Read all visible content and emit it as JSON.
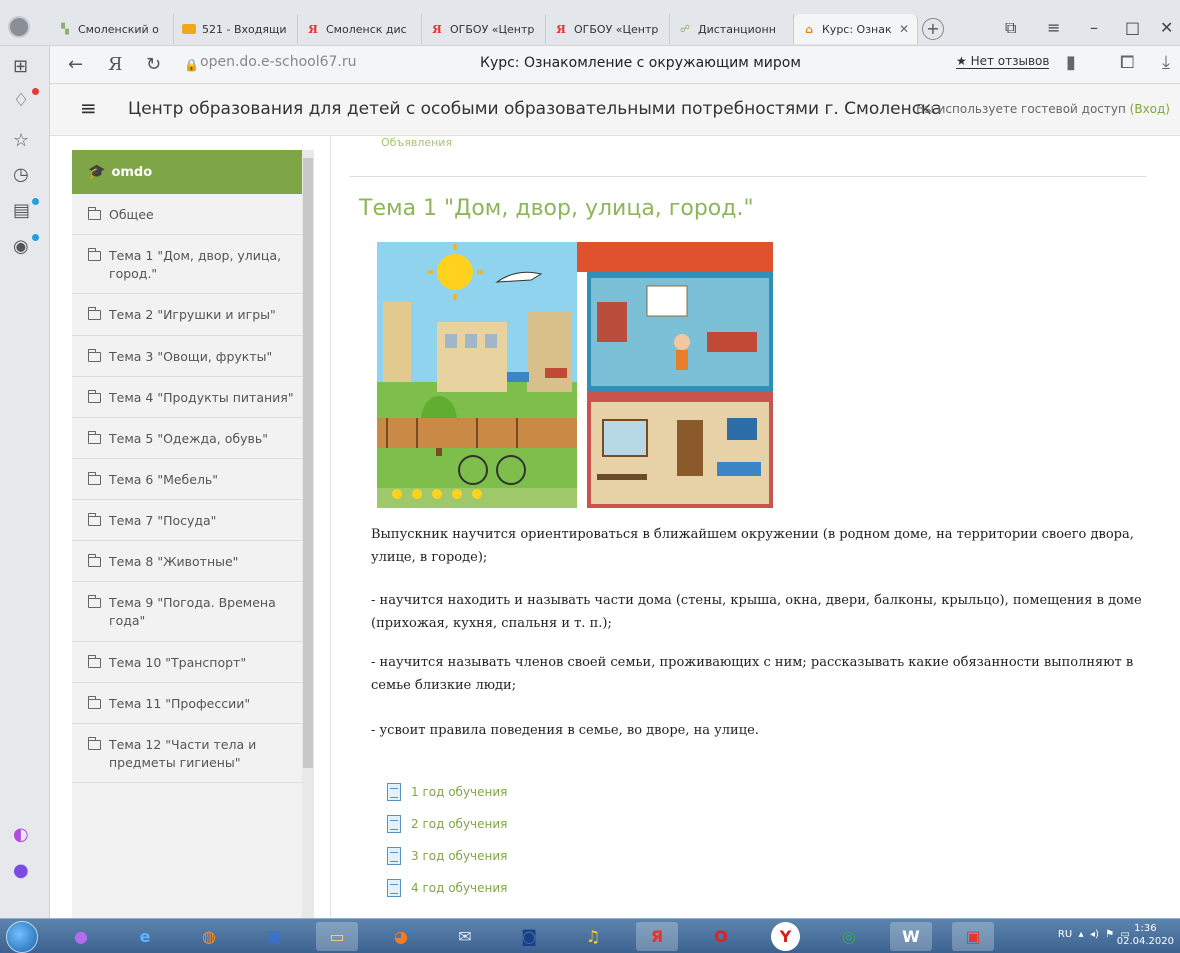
{
  "browser": {
    "tabs": [
      {
        "label": "Смоленский о",
        "icon": "ms-icon"
      },
      {
        "label": "521 - Входящи",
        "icon": "mail-icon"
      },
      {
        "label": "Смоленск дис",
        "icon": "yandex-icon"
      },
      {
        "label": "ОГБОУ «Центр",
        "icon": "yandex-icon"
      },
      {
        "label": "ОГБОУ «Центр",
        "icon": "yandex-icon"
      },
      {
        "label": "Дистанционн",
        "icon": "remote-icon"
      },
      {
        "label": "Курс: Ознак",
        "icon": "omdo-icon",
        "active": true
      }
    ],
    "url": "open.do.e-school67.ru",
    "page_title": "Курс: Ознакомление с окружающим миром",
    "reviews": "★ Нет отзывов"
  },
  "header": {
    "site_name": "Центр образования для детей с особыми образовательными потребностями г. Смоленска",
    "guest_text": "Вы используете гостевой доступ",
    "login_label": "(Вход)"
  },
  "coursenav": {
    "brand": "omdo",
    "items": [
      "Общее",
      "Тема 1 \"Дом, двор, улица, город.\"",
      "Тема 2 \"Игрушки и игры\"",
      "Тема 3 \"Овощи, фрукты\"",
      "Тема 4 \"Продукты питания\"",
      "Тема 5 \"Одежда, обувь\"",
      "Тема 6 \"Мебель\"",
      "Тема 7 \"Посуда\"",
      "Тема 8 \"Животные\"",
      "Тема 9 \"Погода. Времена года\"",
      "Тема 10 \"Транспорт\"",
      "Тема 11 \"Профессии\"",
      "Тема 12 \"Части тела и предметы гигиены\""
    ]
  },
  "main": {
    "cut_link": "Объявления",
    "section_title": "Тема 1 \"Дом, двор, улица, город.\"",
    "paragraphs": [
      "Выпускник научится ориентироваться в ближайшем окружении (в родном доме, на территории своего двора, улице, в городе);",
      "- научится находить и называть части дома (стены, крыша, окна, двери, балконы, крыльцо), помещения в доме (прихожая, кухня, спальня и т. п.);",
      "- научится называть членов своей семьи, проживающих с ним; рассказывать какие обязанности выполняют в семье близкие люди;",
      "- усвоит правила поведения в семье, во дворе, на улице."
    ],
    "resources": [
      "1 год обучения",
      "2 год обучения",
      "3 год обучения",
      "4 год обучения"
    ]
  },
  "taskbar": {
    "lang": "RU",
    "time": "1:36",
    "date": "02.04.2020"
  },
  "colors": {
    "accent": "#7fa646",
    "title": "#8fb55b"
  }
}
